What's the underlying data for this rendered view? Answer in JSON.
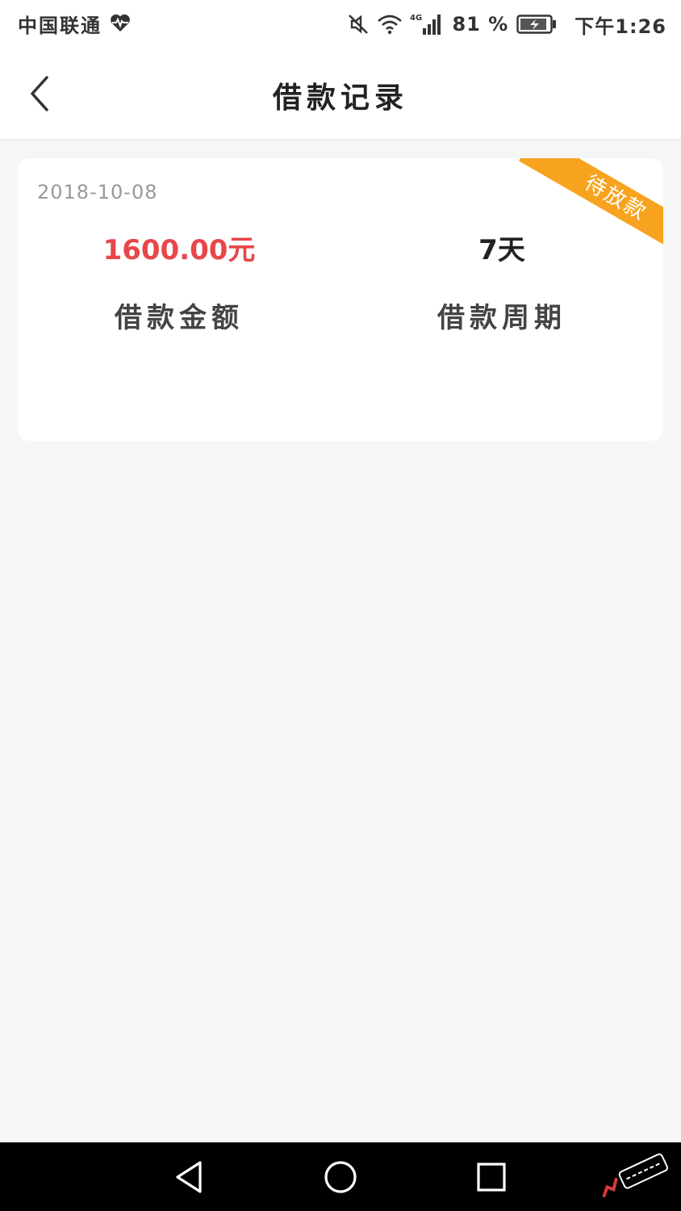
{
  "status_bar": {
    "carrier": "中国联通",
    "battery_percent": "81 %",
    "time": "下午1:26",
    "icons": [
      "heart-pulse-icon",
      "mute-icon",
      "wifi-icon",
      "signal-4g-icon",
      "battery-charging-icon"
    ]
  },
  "header": {
    "title": "借款记录",
    "back_icon": "chevron-left-icon"
  },
  "loan_record": {
    "date": "2018-10-08",
    "status": "待放款",
    "amount": "1600.00元",
    "amount_label": "借款金额",
    "period": "7天",
    "period_label": "借款周期"
  },
  "nav_bar": {
    "icons": [
      "nav-back-icon",
      "nav-home-icon",
      "nav-recent-icon"
    ]
  },
  "colors": {
    "accent_red": "#e8474a",
    "ribbon_orange": "#f7a31f",
    "background": "#f6f6f6"
  }
}
